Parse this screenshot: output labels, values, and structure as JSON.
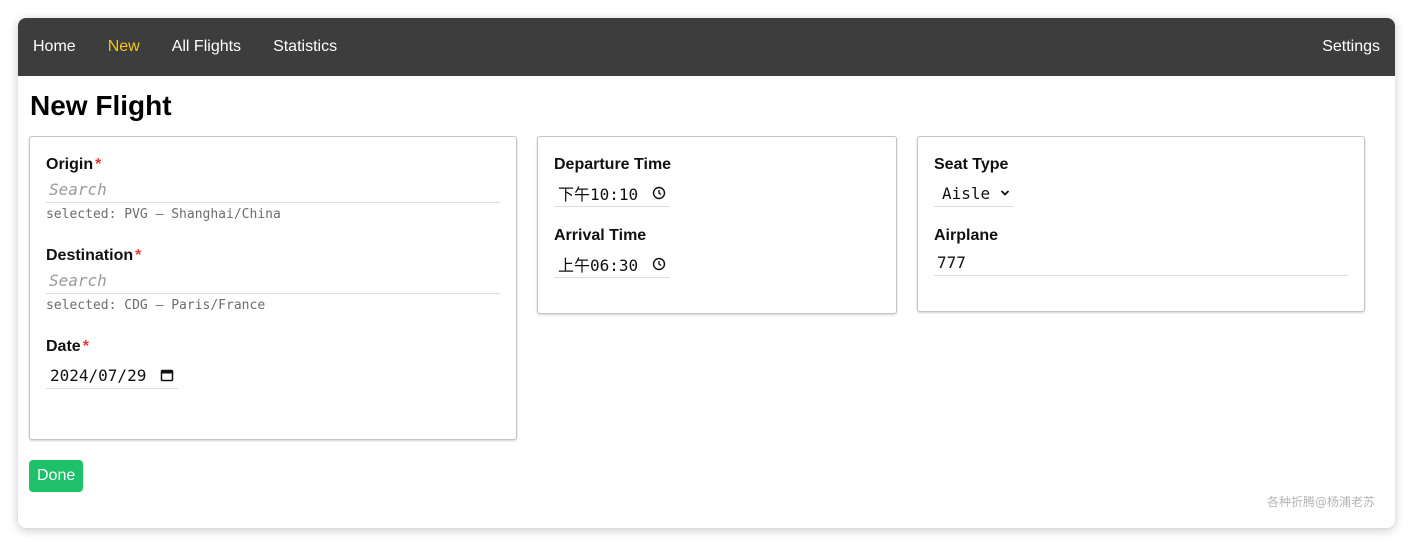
{
  "nav": {
    "items": [
      {
        "label": "Home",
        "active": false
      },
      {
        "label": "New",
        "active": true
      },
      {
        "label": "All Flights",
        "active": false
      },
      {
        "label": "Statistics",
        "active": false
      }
    ],
    "settings_label": "Settings",
    "accent_color": "#f5c518",
    "bg_color": "#3d3d3d"
  },
  "page": {
    "title": "New Flight"
  },
  "origin": {
    "label": "Origin",
    "required_mark": "*",
    "placeholder": "Search",
    "value": "",
    "selected_text": "selected: PVG – Shanghai/China"
  },
  "destination": {
    "label": "Destination",
    "required_mark": "*",
    "placeholder": "Search",
    "value": "",
    "selected_text": "selected: CDG – Paris/France"
  },
  "date": {
    "label": "Date",
    "required_mark": "*",
    "value": "2024/07/29",
    "icon": "calendar-icon"
  },
  "departure": {
    "label": "Departure Time",
    "value": "下午10:10",
    "icon": "clock-icon"
  },
  "arrival": {
    "label": "Arrival Time",
    "value": "上午06:30",
    "icon": "clock-icon"
  },
  "seat": {
    "label": "Seat Type",
    "selected": "Aisle",
    "icon": "chevron-down-icon"
  },
  "airplane": {
    "label": "Airplane",
    "value": "777"
  },
  "done_button": {
    "label": "Done",
    "color": "#1fc06a"
  },
  "watermark": "各种折腾@杨浦老苏"
}
